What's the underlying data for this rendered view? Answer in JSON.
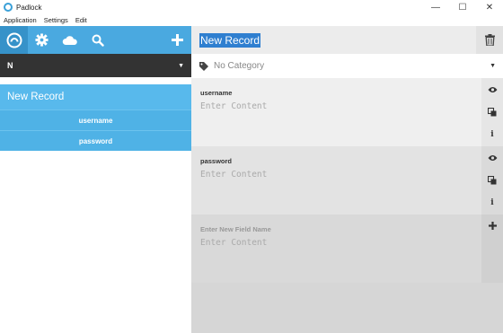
{
  "window": {
    "title": "Padlock",
    "controls": [
      "—",
      "☐",
      "✕"
    ]
  },
  "menu": [
    "Application",
    "Settings",
    "Edit"
  ],
  "toolbar": {
    "icons": [
      "logo-icon",
      "gear-icon",
      "cloud-icon",
      "search-icon",
      "add-icon"
    ],
    "accent": "#4aa9e0"
  },
  "filter": {
    "value": "N"
  },
  "records": [
    {
      "name": "New Record",
      "fields": [
        "username",
        "password"
      ]
    }
  ],
  "record": {
    "title": "New Record",
    "category_placeholder": "No Category",
    "fields": [
      {
        "label": "username",
        "placeholder": "Enter Content"
      },
      {
        "label": "password",
        "placeholder": "Enter Content"
      }
    ],
    "new_field": {
      "label": "Enter New Field Name",
      "placeholder": "Enter Content"
    }
  }
}
